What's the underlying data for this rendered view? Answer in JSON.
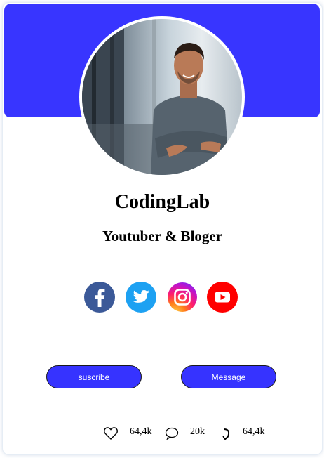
{
  "profile": {
    "name": "CodingLab",
    "role": "Youtuber & Bloger"
  },
  "colors": {
    "accent": "#3835ff",
    "facebook": "#3b5998",
    "twitter": "#1da1f2",
    "youtube": "#ff0000"
  },
  "social": [
    {
      "network": "facebook",
      "icon": "facebook-icon"
    },
    {
      "network": "twitter",
      "icon": "twitter-icon"
    },
    {
      "network": "instagram",
      "icon": "instagram-icon"
    },
    {
      "network": "youtube",
      "icon": "youtube-icon"
    }
  ],
  "buttons": {
    "subscribe_label": "suscribe",
    "message_label": "Message"
  },
  "stats": {
    "likes": "64,4k",
    "comments": "20k",
    "shares": "64,4k",
    "icons": [
      "heart-icon",
      "comment-icon",
      "share-icon"
    ]
  }
}
